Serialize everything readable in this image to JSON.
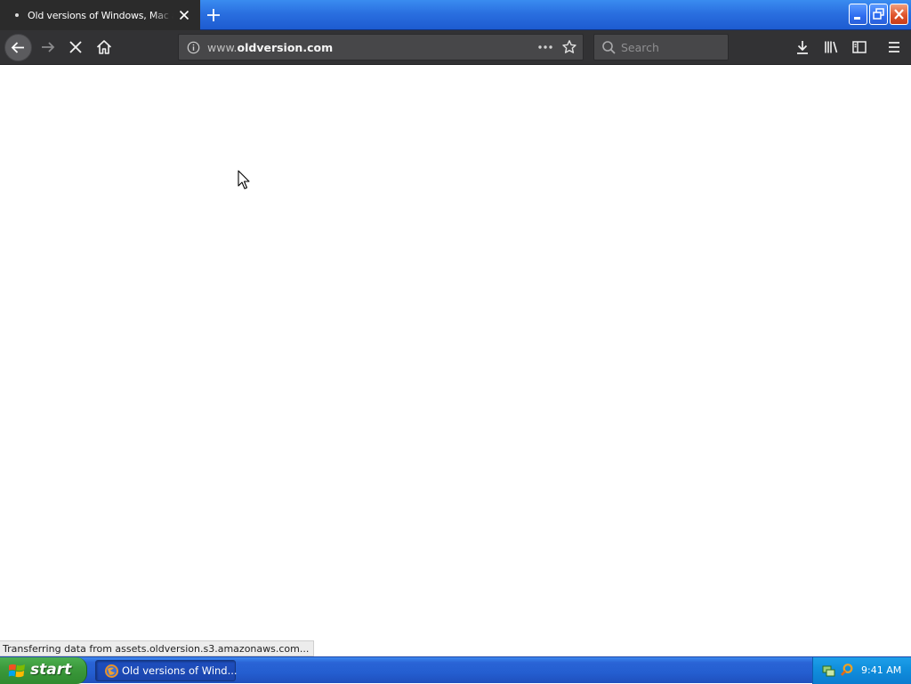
{
  "browser": {
    "tab": {
      "title": "Old versions of Windows, Mac and Linux Software"
    },
    "address_bar": {
      "prefix": "www.",
      "domain": "oldversion.com"
    },
    "search": {
      "placeholder": "Search"
    },
    "status_text": "Transferring data from assets.oldversion.s3.amazonaws.com..."
  },
  "taskbar": {
    "start_label": "start",
    "task_label": "Old versions of Wind...",
    "clock": "9:41 AM"
  },
  "colors": {
    "tab_strip": "#2a6fe0",
    "toolbar": "#323234",
    "taskbar": "#245ed0",
    "start_button": "#3c9a3c"
  },
  "icons": [
    "loading-dot-icon",
    "close-tab-icon",
    "new-tab-icon",
    "minimize-icon",
    "restore-icon",
    "window-close-icon",
    "back-arrow-icon",
    "forward-arrow-icon",
    "stop-icon",
    "home-icon",
    "info-icon",
    "page-actions-icon",
    "bookmark-star-icon",
    "search-icon",
    "download-icon",
    "library-icon",
    "sidebar-icon",
    "menu-icon",
    "windows-logo-icon",
    "firefox-icon",
    "network-icon",
    "security-icon",
    "mouse-cursor-icon"
  ]
}
